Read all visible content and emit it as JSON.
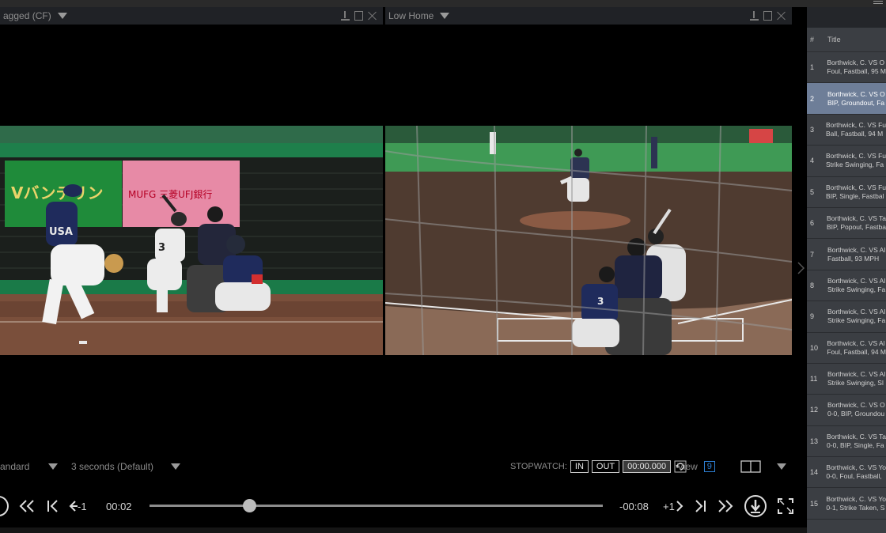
{
  "left_panel": {
    "title": "agged (CF)"
  },
  "right_panel": {
    "title": "Low Home"
  },
  "left_video": {
    "sign_left": "Vバンテリン",
    "sign_right": "MUFG 三菱UFJ銀行",
    "jersey_text": "USA",
    "batter_number": "3"
  },
  "right_video": {
    "ad_text": "",
    "catcher_number": "3"
  },
  "controls": {
    "speed": "andard",
    "skip_interval": "3 seconds (Default)",
    "stopwatch_label": "STOPWATCH:",
    "in_label": "IN",
    "out_label": "OUT",
    "stopwatch_time": "00:00.000",
    "view_label": "View",
    "view_value": "9"
  },
  "transport": {
    "step_back_label": "-1",
    "current_time": "00:02",
    "remaining_time": "-00:08",
    "step_forward_label": "+1",
    "progress": 0.22
  },
  "playlist": {
    "col_num": "#",
    "col_title": "Title",
    "items": [
      {
        "num": "1",
        "line1": "Borthwick, C. VS O",
        "line2": "Foul, Fastball, 95 M"
      },
      {
        "num": "2",
        "line1": "Borthwick, C. VS O",
        "line2": "BIP, Groundout, Fa",
        "selected": true
      },
      {
        "num": "3",
        "line1": "Borthwick, C. VS Fu",
        "line2": "Ball, Fastball, 94 M"
      },
      {
        "num": "4",
        "line1": "Borthwick, C. VS Fu",
        "line2": "Strike Swinging, Fa"
      },
      {
        "num": "5",
        "line1": "Borthwick, C. VS Fu",
        "line2": "BIP, Single, Fastbal"
      },
      {
        "num": "6",
        "line1": "Borthwick, C. VS Ta",
        "line2": "BIP, Popout, Fastba"
      },
      {
        "num": "7",
        "line1": "Borthwick, C. VS Al",
        "line2": "Fastball, 93 MPH"
      },
      {
        "num": "8",
        "line1": "Borthwick, C. VS Al",
        "line2": "Strike Swinging, Fa"
      },
      {
        "num": "9",
        "line1": "Borthwick, C. VS Al",
        "line2": "Strike Swinging, Fa"
      },
      {
        "num": "10",
        "line1": "Borthwick, C. VS Al",
        "line2": "Foul, Fastball, 94 M"
      },
      {
        "num": "11",
        "line1": "Borthwick, C. VS Al",
        "line2": "Strike Swinging, Sl"
      },
      {
        "num": "12",
        "line1": "Borthwick, C. VS O",
        "line2": "0-0, BIP, Groundou"
      },
      {
        "num": "13",
        "line1": "Borthwick, C. VS Ta",
        "line2": "0-0, BIP, Single, Fa"
      },
      {
        "num": "14",
        "line1": "Borthwick, C. VS Yo",
        "line2": "0-0, Foul, Fastball,"
      },
      {
        "num": "15",
        "line1": "Borthwick, C. VS Yo",
        "line2": "0-1, Strike Taken, S"
      }
    ]
  }
}
